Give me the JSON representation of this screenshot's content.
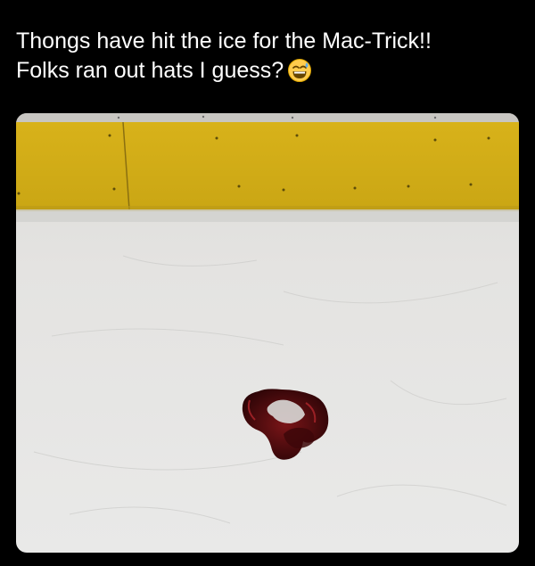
{
  "post": {
    "line1": "Thongs have hit the ice for the Mac-Trick!!",
    "line2": "Folks ran out hats I guess?",
    "emoji_icon": "grinning-sweat-emoji"
  },
  "media": {
    "description_icon": "rink-photo",
    "colors": {
      "board_yellow": "#d9b51c",
      "kick_plate_top": "#c9c7c4",
      "ice": "#e6e6e4",
      "thong": "#5a0f12"
    }
  }
}
